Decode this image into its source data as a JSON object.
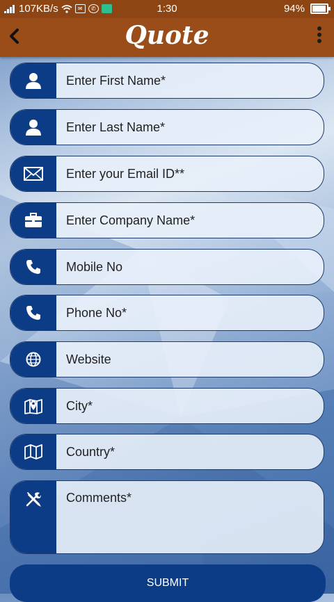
{
  "status_bar": {
    "network_speed": "107KB/s",
    "time": "1:30",
    "battery": "94%"
  },
  "app_bar": {
    "title": "Quote"
  },
  "form": {
    "first_name": {
      "placeholder": "Enter First Name*",
      "icon": "person-icon"
    },
    "last_name": {
      "placeholder": "Enter Last Name*",
      "icon": "person-icon"
    },
    "email": {
      "placeholder": "Enter your Email ID**",
      "icon": "envelope-icon"
    },
    "company": {
      "placeholder": "Enter Company Name*",
      "icon": "briefcase-icon"
    },
    "mobile": {
      "placeholder": "Mobile No",
      "icon": "phone-icon"
    },
    "phone": {
      "placeholder": "Phone No*",
      "icon": "phone-icon"
    },
    "website": {
      "placeholder": "Website",
      "icon": "globe-icon"
    },
    "city": {
      "placeholder": "City*",
      "icon": "map-pin-icon"
    },
    "country": {
      "placeholder": "Country*",
      "icon": "map-icon"
    },
    "comments": {
      "placeholder": "Comments*",
      "icon": "tools-icon"
    }
  },
  "submit_label": "SUBMIT",
  "colors": {
    "status_bar": "#8e4514",
    "app_bar": "#9a4d18",
    "field_icon_bg": "#0d3c86",
    "field_bg": "#e8f0fa"
  }
}
